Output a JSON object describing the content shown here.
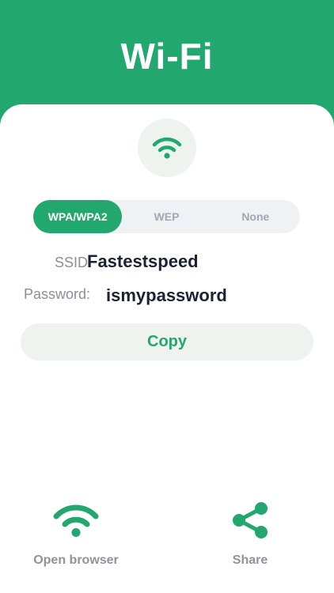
{
  "header": {
    "title": "Wi-Fi"
  },
  "security": {
    "options": [
      "WPA/WPA2",
      "WEP",
      "None"
    ],
    "selected": "WPA/WPA2"
  },
  "network": {
    "ssid_label": "SSID:",
    "ssid": "Fastestspeed",
    "password_label": "Password:",
    "password": "ismypassword"
  },
  "copy_label": "Copy",
  "actions": {
    "open_browser": "Open browser",
    "share": "Share"
  },
  "icons": {
    "header_icon": "wifi-icon",
    "open_browser_icon": "wifi-icon",
    "share_icon": "share-icon"
  },
  "colors": {
    "accent": "#22a86f",
    "text_dark": "#1c2133",
    "text_muted": "#8a8f98",
    "segment_bg": "#f0f1f4",
    "soft_green": "#eef3f0"
  }
}
